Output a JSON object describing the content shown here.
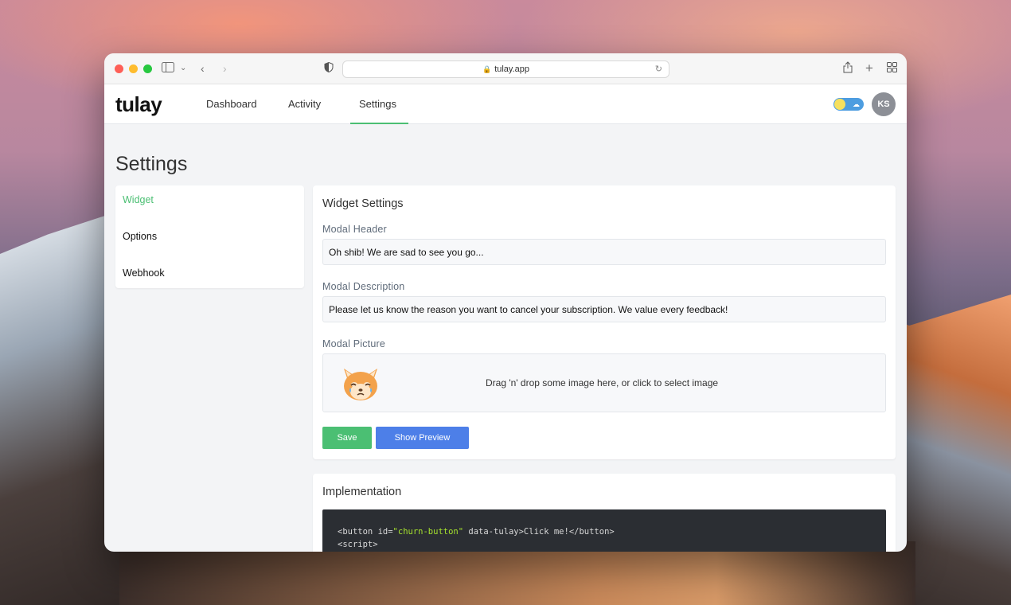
{
  "browser": {
    "url": "tulay.app"
  },
  "app": {
    "logo": "tulay",
    "nav": [
      {
        "label": "Dashboard"
      },
      {
        "label": "Activity"
      },
      {
        "label": "Settings"
      }
    ],
    "active_nav": "Settings",
    "avatar_initials": "KS"
  },
  "page": {
    "title": "Settings"
  },
  "sidebar": {
    "items": [
      {
        "label": "Widget",
        "active": true
      },
      {
        "label": "Options",
        "active": false
      },
      {
        "label": "Webhook",
        "active": false
      }
    ]
  },
  "widget_settings": {
    "title": "Widget Settings",
    "modal_header_label": "Modal Header",
    "modal_header_value": "Oh shib! We are sad to see you go...",
    "modal_description_label": "Modal Description",
    "modal_description_value": "Please let us know the reason you want to cancel your subscription. We value every feedback!",
    "modal_picture_label": "Modal Picture",
    "dropzone_text": "Drag 'n' drop some image here, or click to select image",
    "save_label": "Save",
    "preview_label": "Show Preview"
  },
  "implementation": {
    "title": "Implementation",
    "code_line1_pre": "<button id=",
    "code_line1_str": "\"churn-button\"",
    "code_line1_post": " data-tulay>Click me!</button>",
    "code_line2": "<script>"
  },
  "colors": {
    "accent_green": "#4bbf73",
    "accent_blue": "#4d7fe8"
  }
}
